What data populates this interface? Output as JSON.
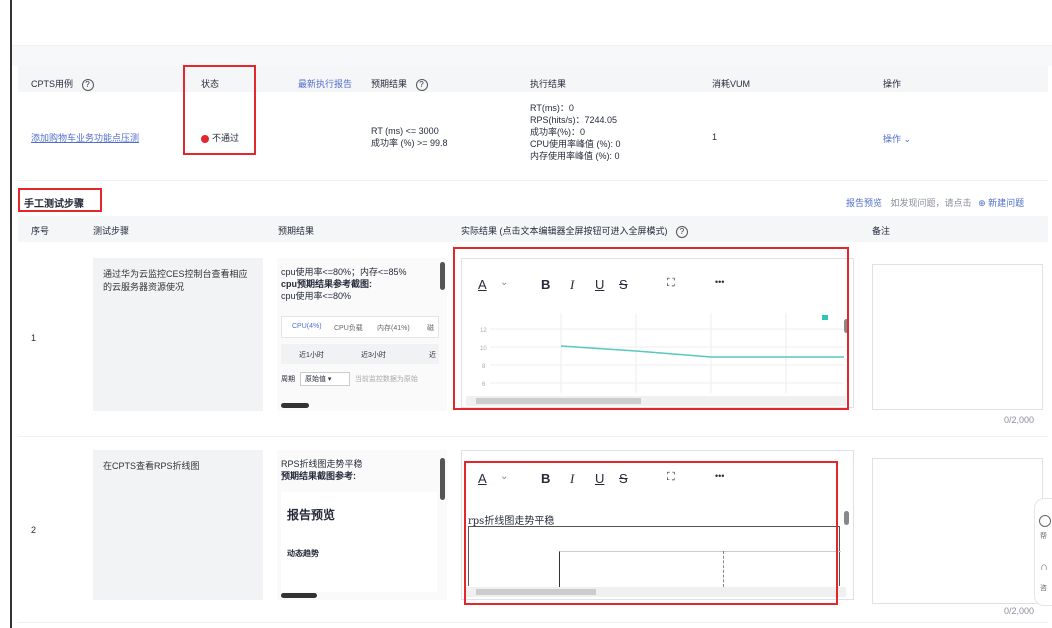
{
  "cases_table": {
    "headers": {
      "case": "CPTS用例",
      "status": "状态",
      "latest_report": "最新执行报告",
      "expected": "预期结果",
      "exec_result": "执行结果",
      "vum": "消耗VUM",
      "ops": "操作"
    },
    "row": {
      "case_link": "添加购物车业务功能点压测",
      "status": "不通过",
      "expected_rt": "RT (ms) <= 3000",
      "expected_success": "成功率 (%) >= 99.8",
      "result_rt": "RT(ms)：0",
      "result_rps": "RPS(hits/s)：7244.05",
      "result_success": "成功率(%)：0",
      "result_cpu": "CPU使用率峰值 (%): 0",
      "result_mem": "内存使用率峰值 (%): 0",
      "vum": "1",
      "ops": "操作"
    }
  },
  "manual": {
    "title": "手工测试步骤",
    "report_preview": "报告预览",
    "issue_hint": "如发现问题，请点击",
    "new_issue": "新建问题",
    "headers": {
      "no": "序号",
      "step": "测试步骤",
      "expected": "预期结果",
      "actual": "实际结果 (点击文本编辑器全屏按钮可进入全屏模式)",
      "note": "备注"
    },
    "rows": [
      {
        "no": "1",
        "step": "通过华为云监控CES控制台查看相应的云服务器资源使况",
        "exp_line1": "cpu使用率<=80%；内存<=85%",
        "exp_bold": "cpu预期结果参考截图:",
        "exp_line3": "cpu使用率<=80%",
        "mini_tabs": [
          "CPU(4%)",
          "CPU负载",
          "内存(41%)",
          "磁"
        ],
        "mini_ranges": [
          "近1小时",
          "近3小时",
          "近"
        ],
        "mini_period_label": "周期",
        "mini_period_value": "原始值",
        "mini_hint": "当前监控数据为原始",
        "chart_yticks": [
          "12",
          "10",
          "8",
          "6"
        ],
        "counter": "0/2,000"
      },
      {
        "no": "2",
        "step": "在CPTS查看RPS折线图",
        "exp_line1": "RPS折线图走势平稳",
        "exp_bold": "预期结果截图参考:",
        "preview_title": "报告预览",
        "preview_sub": "动态趋势",
        "actual_text": "rps折线图走势平稳",
        "counter": "0/2,000"
      }
    ]
  },
  "editor": {
    "font_color": "A",
    "bold": "B",
    "italic": "I",
    "underline": "U",
    "strike": "S",
    "more": "•••"
  },
  "float": {
    "help": "帮",
    "consult": "咨"
  }
}
